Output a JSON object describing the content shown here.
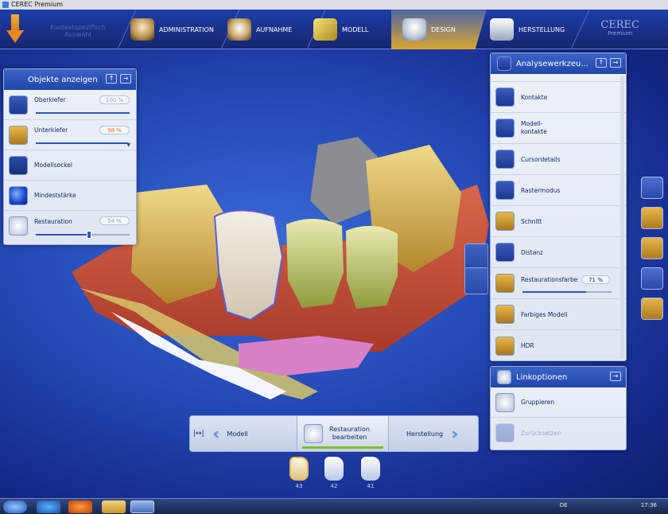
{
  "window_title": "CEREC Premium",
  "toolbar": {
    "ghost_text": [
      "Kontextspezifisch",
      "Auswahl"
    ],
    "steps": [
      {
        "label": "ADMINISTRATION",
        "icon": "jaw-icon"
      },
      {
        "label": "AUFNAHME",
        "icon": "scan-jaw-icon"
      },
      {
        "label": "MODELL",
        "icon": "model-block-icon"
      },
      {
        "label": "DESIGN",
        "icon": "design-tooth-icon",
        "active": true
      },
      {
        "label": "HERSTELLUNG",
        "icon": "milling-unit-icon"
      }
    ],
    "brand": "CEREC",
    "brand_sub": "Premium"
  },
  "objects_panel": {
    "title": "Objekte anzeigen",
    "items": [
      {
        "label": "Oberkiefer",
        "value": "100 %",
        "icon": "upper-jaw-icon",
        "has_slider": true,
        "level": 100
      },
      {
        "label": "Unterkiefer",
        "value": "98 %",
        "icon": "lower-jaw-icon",
        "has_slider": true,
        "level": 98,
        "highlight": true
      },
      {
        "label": "Modellsockel",
        "icon": "model-base-icon"
      },
      {
        "label": "Mindeststärke",
        "icon": "min-thickness-icon"
      },
      {
        "label": "Restauration",
        "value": "54 %",
        "icon": "restoration-icon",
        "has_slider": true,
        "level": 54
      }
    ]
  },
  "analysis_panel": {
    "title": "Analysewerkzeu...",
    "items": [
      {
        "label": "Kontakte",
        "icon": "contacts-icon"
      },
      {
        "label": "Modell-\nkontakte",
        "icon": "model-contacts-icon"
      },
      {
        "label": "Cursordetails",
        "icon": "cursor-details-icon"
      },
      {
        "label": "Rastermodus",
        "icon": "grid-mode-icon"
      },
      {
        "label": "Schnitt",
        "icon": "section-icon"
      },
      {
        "label": "Distanz",
        "icon": "distance-icon"
      },
      {
        "label": "Restaurationsfarbe",
        "value": "71 %",
        "icon": "restoration-color-icon",
        "level": 71
      },
      {
        "label": "Farbiges Modell",
        "icon": "colored-model-icon"
      },
      {
        "label": "HDR",
        "icon": "hdr-icon"
      }
    ]
  },
  "link_panel": {
    "title": "Linkoptionen",
    "items": [
      {
        "label": "Gruppieren",
        "icon": "group-icon",
        "enabled": true
      },
      {
        "label": "Zurücksetzen",
        "icon": "reset-icon",
        "enabled": false
      }
    ]
  },
  "workflow": {
    "prev": "Modell",
    "current": "Restauration\nbearbeiten",
    "next": "Herstellung"
  },
  "teeth": [
    {
      "number": "43",
      "selected": true
    },
    {
      "number": "42",
      "selected": false
    },
    {
      "number": "41",
      "selected": false
    }
  ],
  "taskbar": {
    "language": "DE",
    "time": "17:36"
  }
}
